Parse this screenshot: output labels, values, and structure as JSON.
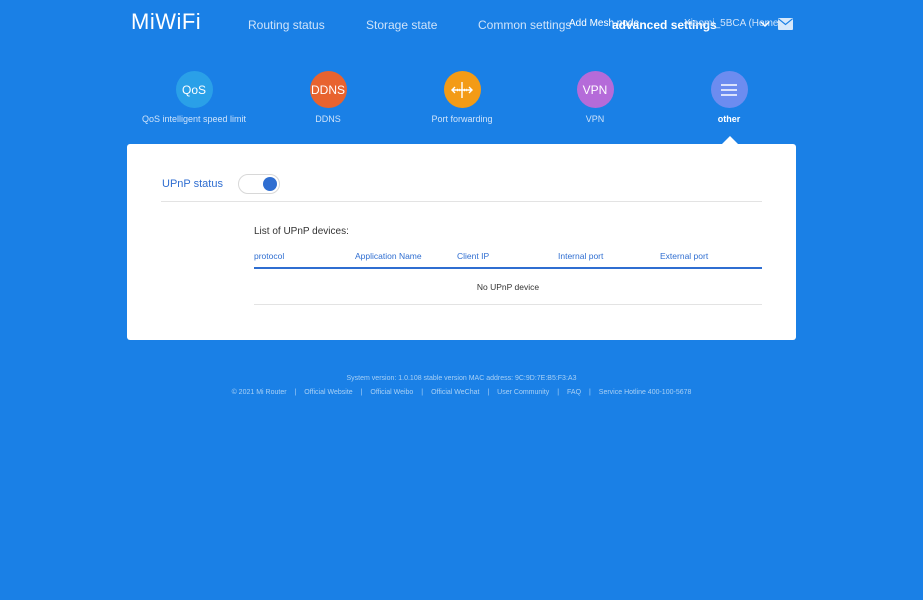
{
  "brand": {
    "logo": "MiWiFi"
  },
  "nav": {
    "routing_status": "Routing status",
    "storage_state": "Storage state",
    "common_settings": "Common settings",
    "advanced_settings": "advanced settings",
    "add_mesh": "Add Mesh node",
    "router_name": "Xiaomi_5BCA (Home)"
  },
  "tools": [
    {
      "icon": "QoS",
      "label": "QoS intelligent speed limit",
      "color": "#2aa0e8"
    },
    {
      "icon": "DDNS",
      "label": "DDNS",
      "color": "#e8632f"
    },
    {
      "icon": "port-forward-icon",
      "label": "Port forwarding",
      "color": "#f39b16"
    },
    {
      "icon": "VPN",
      "label": "VPN",
      "color": "#b56bd9"
    },
    {
      "icon": "menu-icon",
      "label": "other",
      "color": "#6c8cf0"
    }
  ],
  "panel": {
    "upnp_label": "UPnP status",
    "upnp_enabled": true,
    "list_title": "List of UPnP devices:",
    "columns": [
      "protocol",
      "Application Name",
      "Client IP",
      "Internal port",
      "External port"
    ],
    "empty_text": "No UPnP device"
  },
  "footer": {
    "system_line": "System version: 1.0.108 stable version MAC address: 9C:9D:7E:B5:F3:A3",
    "copyright": "© 2021 Mi Router",
    "links": [
      "Official Website",
      "Official Weibo",
      "Official WeChat",
      "User Community",
      "FAQ",
      "Service Hotline 400-100-5678"
    ],
    "separator": "|"
  },
  "colors": {
    "background": "#1a80e6",
    "accent": "#2f6ed1"
  }
}
